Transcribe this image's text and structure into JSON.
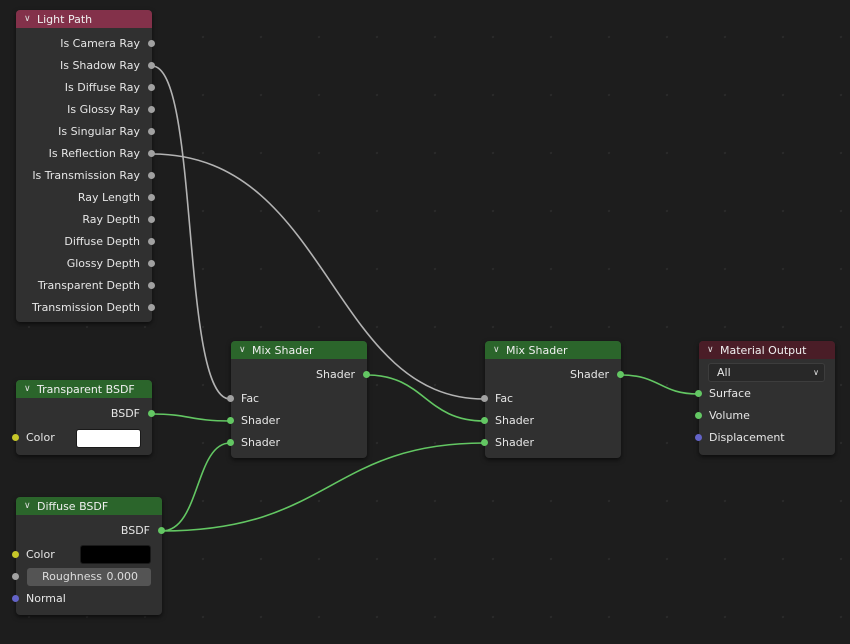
{
  "nodes": {
    "light_path": {
      "title": "Light Path",
      "outputs": [
        "Is Camera Ray",
        "Is Shadow Ray",
        "Is Diffuse Ray",
        "Is Glossy Ray",
        "Is Singular Ray",
        "Is Reflection Ray",
        "Is Transmission Ray",
        "Ray Length",
        "Ray Depth",
        "Diffuse Depth",
        "Glossy Depth",
        "Transparent Depth",
        "Transmission Depth"
      ]
    },
    "transparent_bsdf": {
      "title": "Transparent BSDF",
      "output": "BSDF",
      "color_label": "Color",
      "color_value": "#ffffff"
    },
    "diffuse_bsdf": {
      "title": "Diffuse BSDF",
      "output": "BSDF",
      "color_label": "Color",
      "color_value": "#000000",
      "roughness_label": "Roughness",
      "roughness_value": "0.000",
      "normal_label": "Normal"
    },
    "mix_shader_1": {
      "title": "Mix Shader",
      "output": "Shader",
      "inputs": [
        "Fac",
        "Shader",
        "Shader"
      ]
    },
    "mix_shader_2": {
      "title": "Mix Shader",
      "output": "Shader",
      "inputs": [
        "Fac",
        "Shader",
        "Shader"
      ]
    },
    "material_output": {
      "title": "Material Output",
      "target": "All",
      "inputs": [
        "Surface",
        "Volume",
        "Displacement"
      ]
    }
  },
  "colors": {
    "shader_socket": "#63c763",
    "float_socket": "#a1a1a1",
    "color_socket": "#c7c729",
    "vector_socket": "#6363c7",
    "light_path_header": "#83314a",
    "shader_header": "#2b652b",
    "output_header": "#4a1d27"
  }
}
